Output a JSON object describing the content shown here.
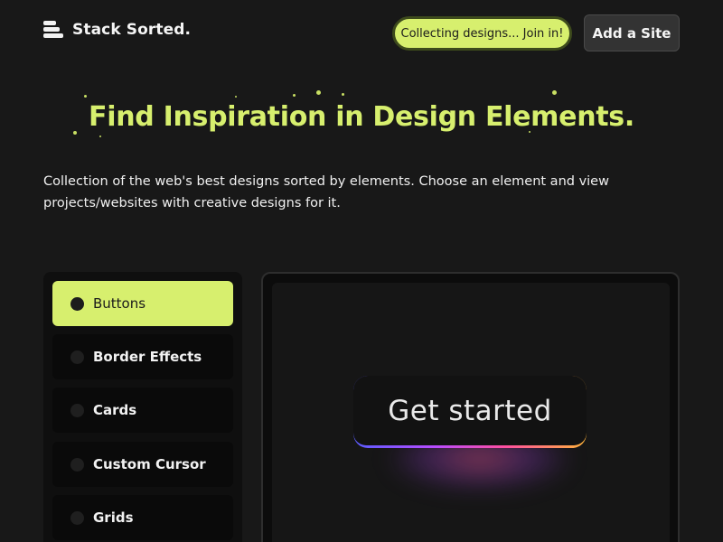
{
  "header": {
    "logo_text": "Stack Sorted.",
    "pill_text": "Collecting designs... Join in!",
    "add_site_label": "Add a Site"
  },
  "hero": {
    "title": "Find Inspiration in Design Elements.",
    "description": "Collection of the web's best designs sorted by elements. Choose an element and view projects/websites with creative designs for it."
  },
  "sidebar": {
    "items": [
      {
        "label": "Buttons",
        "active": true
      },
      {
        "label": "Border Effects",
        "active": false
      },
      {
        "label": "Cards",
        "active": false
      },
      {
        "label": "Custom Cursor",
        "active": false
      },
      {
        "label": "Grids",
        "active": false
      }
    ]
  },
  "preview": {
    "button_label": "Get started"
  },
  "colors": {
    "background": "#181818",
    "accent": "#d7ef6e",
    "button_dark": "#333333"
  }
}
